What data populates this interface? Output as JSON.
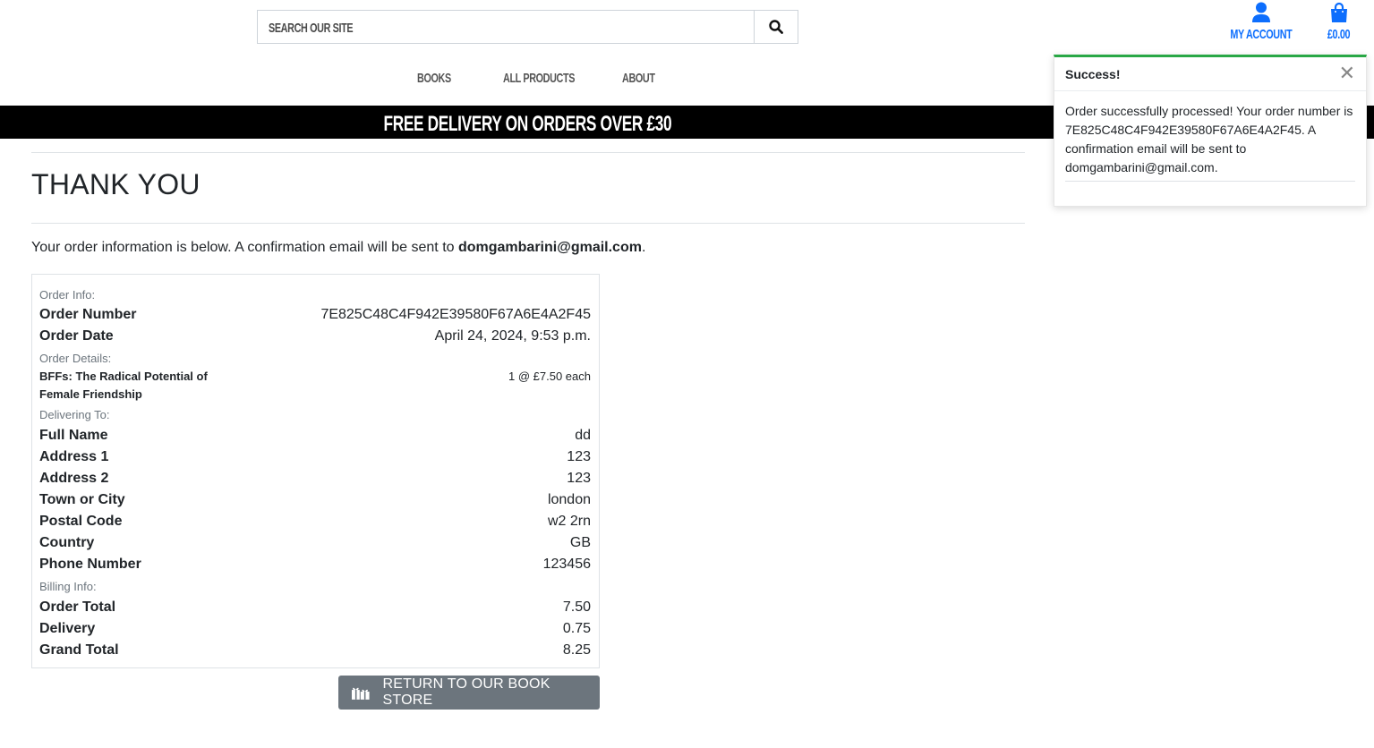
{
  "header": {
    "search_placeholder": "SEARCH OUR SITE",
    "account_label": "MY ACCOUNT",
    "bag_total": "£0.00",
    "accent_color": "#0d6efd"
  },
  "nav": {
    "items": [
      "BOOKS",
      "ALL PRODUCTS",
      "ABOUT"
    ]
  },
  "banner": {
    "text": "FREE DELIVERY ON ORDERS OVER £30"
  },
  "toast": {
    "title": "Success!",
    "message": "Order successfully processed! Your order number is 7E825C48C4F942E39580F67A6E4A2F45. A confirmation email will be sent to domgambarini@gmail.com.",
    "close_icon": "close-icon",
    "accent_color": "#28a745"
  },
  "main": {
    "title": "THANK YOU",
    "intro_text": "Your order information is below. A confirmation email will be sent to ",
    "intro_email": "domgambarini@gmail.com",
    "intro_end": "."
  },
  "order": {
    "info_label": "Order Info:",
    "number_label": "Order Number",
    "number": "7E825C48C4F942E39580F67A6E4A2F45",
    "date_label": "Order Date",
    "date": "April 24, 2024, 9:53 p.m.",
    "details_label": "Order Details:",
    "item_name": "BFFs: The Radical Potential of Female Friendship",
    "item_qty": "1 @ £7.50 each",
    "delivering_label": "Delivering To:",
    "full_name_label": "Full Name",
    "full_name": "dd",
    "address1_label": "Address 1",
    "address1": "123",
    "address2_label": "Address 2",
    "address2": "123",
    "town_label": "Town or City",
    "town": "london",
    "postcode_label": "Postal Code",
    "postcode": "w2 2rn",
    "country_label": "Country",
    "country": "GB",
    "phone_label": "Phone Number",
    "phone": "123456",
    "billing_label": "Billing Info:",
    "order_total_label": "Order Total",
    "order_total": "7.50",
    "delivery_label": "Delivery",
    "delivery": "0.75",
    "grand_total_label": "Grand Total",
    "grand_total": "8.25"
  },
  "return_button": {
    "label": "RETURN TO OUR BOOK STORE",
    "icon": "gifts-icon"
  }
}
